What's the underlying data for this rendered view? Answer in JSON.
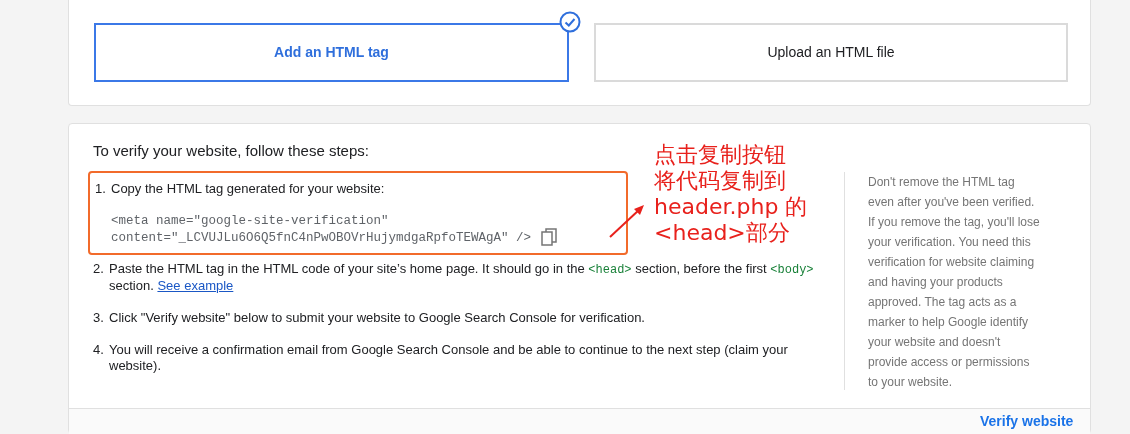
{
  "options": [
    {
      "label": "Add an HTML tag",
      "selected": true
    },
    {
      "label": "Upload an HTML file",
      "selected": false
    }
  ],
  "instructions": {
    "heading": "To verify your website, follow these steps:",
    "steps": [
      {
        "number": "1.",
        "highlighted": true,
        "parts": [
          {
            "kind": "text",
            "text": "Copy the HTML tag generated for your website:"
          }
        ],
        "code_lines": [
          "<meta name=\"google-site-verification\"",
          "content=\"_LCVUJLu6O6Q5fnC4nPwOBOVrHujymdgaRpfoTEWAgA\" />"
        ]
      },
      {
        "number": "2.",
        "highlighted": false,
        "parts": [
          {
            "kind": "text",
            "text": "Paste the HTML tag in the HTML code of your site’s home page. It should go in the"
          },
          {
            "kind": "code",
            "text": "<head>"
          },
          {
            "kind": "text",
            "text": "section, before the first"
          },
          {
            "kind": "code",
            "text": "<body>"
          },
          {
            "kind": "text",
            "text": "section."
          },
          {
            "kind": "link",
            "text": "See example"
          }
        ]
      },
      {
        "number": "3.",
        "highlighted": false,
        "parts": [
          {
            "kind": "text",
            "text": "Click \"Verify website\" below to submit your website to Google Search Console for verification."
          }
        ]
      },
      {
        "number": "4.",
        "highlighted": false,
        "parts": [
          {
            "kind": "text",
            "text": "You will receive a confirmation email from Google Search Console and be able to continue to the next step (claim your website)."
          }
        ]
      }
    ]
  },
  "note": "Don't remove the HTML tag even after you've been verified. If you remove the tag, you'll lose your verification. You need this verification for website claiming and having your products approved. The tag acts as a marker to help Google identify your website and doesn't provide access or permissions to your website.",
  "annotation": {
    "lines": [
      "点击复制按钮",
      "将代码复制到",
      "header.php 的",
      "<head>部分"
    ]
  },
  "footer": {
    "button": "Verify website"
  }
}
